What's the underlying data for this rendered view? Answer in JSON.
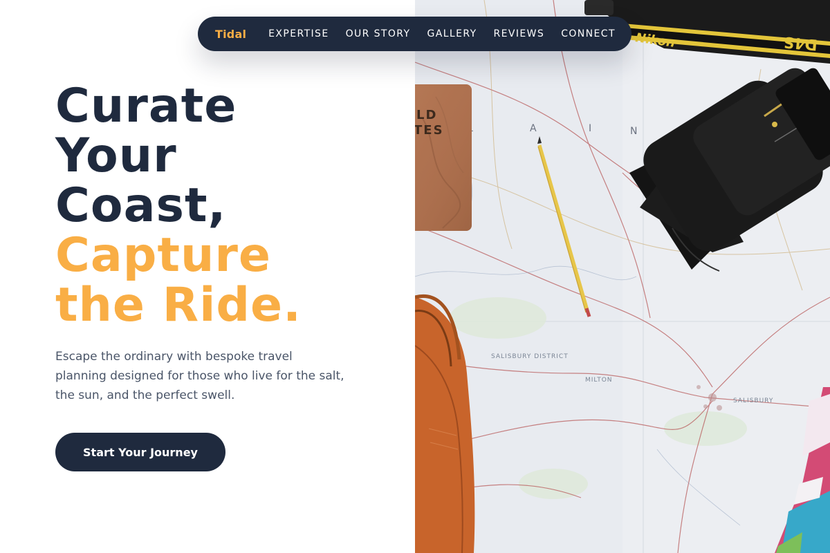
{
  "nav": {
    "brand": "Tidal",
    "links": [
      "EXPERTISE",
      "OUR STORY",
      "GALLERY",
      "REVIEWS",
      "CONNECT"
    ]
  },
  "hero": {
    "headline_dark": [
      "Curate",
      "Your",
      "Coast,"
    ],
    "headline_accent": [
      "Capture",
      "the Ride."
    ],
    "subtitle": "Escape the ordinary with bespoke travel planning designed for those who live for the salt, the sun, and the perfect swell.",
    "cta_label": "Start Your Journey"
  },
  "image": {
    "strap_text": "Nikon",
    "strap_model": "D4S",
    "notebook_text": [
      "LD",
      "TES"
    ],
    "map_labels": [
      "SALISBURY DISTRICT",
      "SALISBURY",
      "MILTON"
    ],
    "map_letters": [
      "L",
      "A",
      "I",
      "N"
    ]
  },
  "colors": {
    "navy": "#1f2a3e",
    "accent": "#f9ae45",
    "body_text": "#4a5568"
  }
}
